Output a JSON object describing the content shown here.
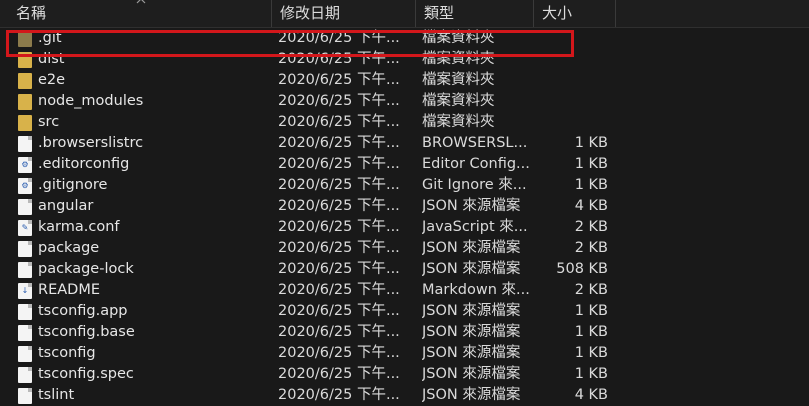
{
  "columns": {
    "name": "名稱",
    "date": "修改日期",
    "type": "類型",
    "size": "大小"
  },
  "files": [
    {
      "name": ".git",
      "date": "2020/6/25 下午...",
      "type": "檔案資料夾",
      "size": "",
      "icon": "folder-dark-icon"
    },
    {
      "name": "dist",
      "date": "2020/6/25 下午...",
      "type": "檔案資料夾",
      "size": "",
      "icon": "folder-icon"
    },
    {
      "name": "e2e",
      "date": "2020/6/25 下午...",
      "type": "檔案資料夾",
      "size": "",
      "icon": "folder-icon"
    },
    {
      "name": "node_modules",
      "date": "2020/6/25 下午...",
      "type": "檔案資料夾",
      "size": "",
      "icon": "folder-icon"
    },
    {
      "name": "src",
      "date": "2020/6/25 下午...",
      "type": "檔案資料夾",
      "size": "",
      "icon": "folder-icon"
    },
    {
      "name": ".browserslistrc",
      "date": "2020/6/25 下午...",
      "type": "BROWSERSL...",
      "size": "1 KB",
      "icon": "file-icon"
    },
    {
      "name": ".editorconfig",
      "date": "2020/6/25 下午...",
      "type": "Editor Config...",
      "size": "1 KB",
      "icon": "gear-file-icon"
    },
    {
      "name": ".gitignore",
      "date": "2020/6/25 下午...",
      "type": "Git Ignore 來...",
      "size": "1 KB",
      "icon": "gear-file-icon"
    },
    {
      "name": "angular",
      "date": "2020/6/25 下午...",
      "type": "JSON 來源檔案",
      "size": "4 KB",
      "icon": "file-icon"
    },
    {
      "name": "karma.conf",
      "date": "2020/6/25 下午...",
      "type": "JavaScript 來...",
      "size": "2 KB",
      "icon": "js-file-icon"
    },
    {
      "name": "package",
      "date": "2020/6/25 下午...",
      "type": "JSON 來源檔案",
      "size": "2 KB",
      "icon": "file-icon"
    },
    {
      "name": "package-lock",
      "date": "2020/6/25 下午...",
      "type": "JSON 來源檔案",
      "size": "508 KB",
      "icon": "file-icon"
    },
    {
      "name": "README",
      "date": "2020/6/25 下午...",
      "type": "Markdown 來...",
      "size": "2 KB",
      "icon": "markdown-file-icon"
    },
    {
      "name": "tsconfig.app",
      "date": "2020/6/25 下午...",
      "type": "JSON 來源檔案",
      "size": "1 KB",
      "icon": "file-icon"
    },
    {
      "name": "tsconfig.base",
      "date": "2020/6/25 下午...",
      "type": "JSON 來源檔案",
      "size": "1 KB",
      "icon": "file-icon"
    },
    {
      "name": "tsconfig",
      "date": "2020/6/25 下午...",
      "type": "JSON 來源檔案",
      "size": "1 KB",
      "icon": "file-icon"
    },
    {
      "name": "tsconfig.spec",
      "date": "2020/6/25 下午...",
      "type": "JSON 來源檔案",
      "size": "1 KB",
      "icon": "file-icon"
    },
    {
      "name": "tslint",
      "date": "2020/6/25 下午...",
      "type": "JSON 來源檔案",
      "size": "4 KB",
      "icon": "file-icon"
    }
  ],
  "colors": {
    "background": "#191919",
    "folder": "#d8b24a",
    "highlight": "#d3171b"
  }
}
